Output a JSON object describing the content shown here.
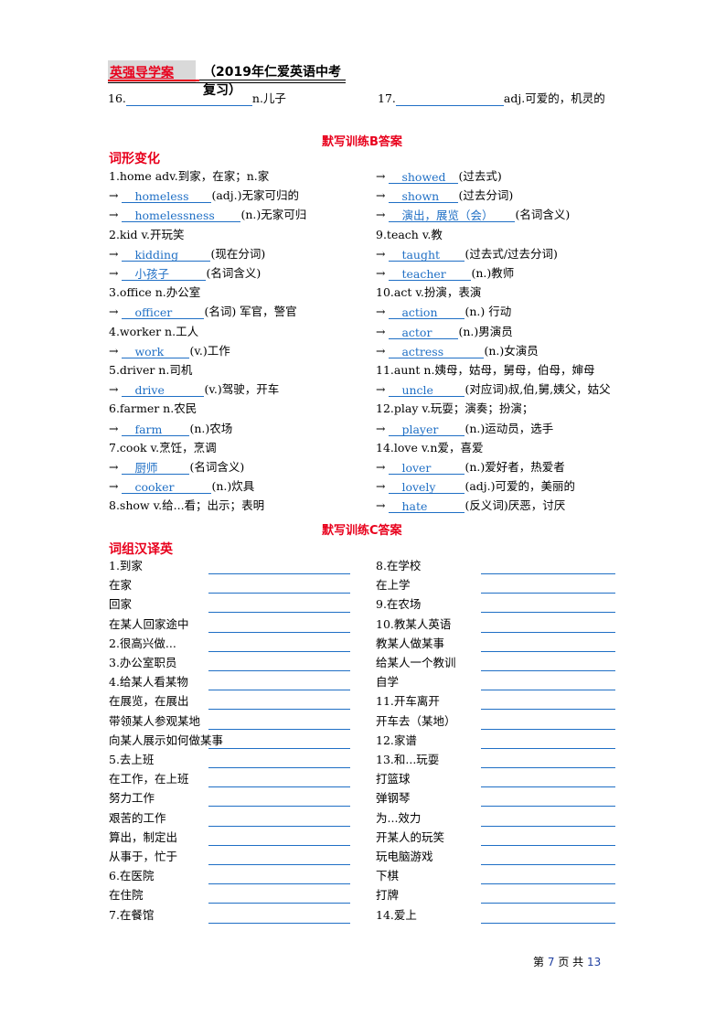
{
  "header": {
    "left": "英强导学案",
    "right": "（2019年仁爱英语中考复习）"
  },
  "top_items": [
    {
      "num": "16.",
      "suffix": "n.儿子"
    },
    {
      "num": "17.",
      "suffix": "adj.可爱的，机灵的"
    }
  ],
  "section_b": {
    "title": "默写训练B答案",
    "subtitle": "词形变化",
    "left_lines": [
      {
        "type": "head",
        "text": "1.home  adv.到家，在家；n.家"
      },
      {
        "type": "ans",
        "answer": "homeless",
        "note": "(adj.)无家可归的"
      },
      {
        "type": "ans",
        "answer": "homelessness",
        "note": "(n.)无家可归"
      },
      {
        "type": "head",
        "text": "2.kid  v.开玩笑"
      },
      {
        "type": "ans",
        "answer": "kidding",
        "note": "(现在分词)"
      },
      {
        "type": "ans",
        "answer": "小孩子",
        "note": "(名词含义)"
      },
      {
        "type": "head",
        "text": "3.office n.办公室"
      },
      {
        "type": "ans",
        "answer": "officer",
        "note": "(名词) 军官，警官"
      },
      {
        "type": "head",
        "text": "4.worker  n.工人"
      },
      {
        "type": "ans",
        "answer": "work",
        "note": "(v.)工作"
      },
      {
        "type": "head",
        "text": "5.driver  n.司机"
      },
      {
        "type": "ans",
        "answer": "drive",
        "note": "(v.)驾驶，开车"
      },
      {
        "type": "head",
        "text": "6.farmer  n.农民"
      },
      {
        "type": "ans",
        "answer": "farm",
        "note": "(n.)农场"
      },
      {
        "type": "head",
        "text": "7.cook  v.烹饪，烹调"
      },
      {
        "type": "ans",
        "answer": "厨师",
        "note": "(名词含义)"
      },
      {
        "type": "ans",
        "answer": "cooker",
        "note": "(n.)炊具"
      },
      {
        "type": "head",
        "text": "8.show  v.给...看；出示；表明"
      }
    ],
    "right_lines": [
      {
        "type": "ans",
        "answer": "showed",
        "note": "(过去式)"
      },
      {
        "type": "ans",
        "answer": "shown",
        "note": "(过去分词)"
      },
      {
        "type": "ans",
        "answer": "演出，展览（会）",
        "note": "(名词含义)"
      },
      {
        "type": "head",
        "text": "9.teach  v.教"
      },
      {
        "type": "ans",
        "answer": "taught",
        "note": "(过去式/过去分词)"
      },
      {
        "type": "ans",
        "answer": "teacher",
        "note": "(n.)教师"
      },
      {
        "type": "head",
        "text": "10.act  v.扮演，表演"
      },
      {
        "type": "ans",
        "answer": "action",
        "note": "(n.) 行动"
      },
      {
        "type": "ans",
        "answer": "actor",
        "note": "(n.)男演员"
      },
      {
        "type": "ans",
        "answer": "actress",
        "note": "(n.)女演员"
      },
      {
        "type": "head",
        "text": "11.aunt  n.姨母，姑母，舅母，伯母，婶母"
      },
      {
        "type": "ans",
        "answer": "uncle",
        "note": "(对应词)叔,伯,舅,姨父，姑父"
      },
      {
        "type": "head",
        "text": "12.play  v.玩耍；演奏；扮演；"
      },
      {
        "type": "ans",
        "answer": "player",
        "note": "(n.)运动员，选手"
      },
      {
        "type": "head",
        "text": "14.love  v.n爱，喜爱"
      },
      {
        "type": "ans",
        "answer": "lover",
        "note": "(n.)爱好者，热爱者"
      },
      {
        "type": "ans",
        "answer": "lovely",
        "note": "(adj.)可爱的，美丽的"
      },
      {
        "type": "ans",
        "answer": "hate",
        "note": "(反义词)厌恶，讨厌"
      }
    ]
  },
  "section_c": {
    "title": "默写训练C答案",
    "subtitle": "词组汉译英",
    "left_items": [
      "1.到家",
      "在家",
      "回家",
      "在某人回家途中",
      "2.很高兴做...",
      "3.办公室职员",
      "4.给某人看某物",
      "在展览，在展出",
      "带领某人参观某地",
      "向某人展示如何做某事",
      "5.去上班",
      "在工作，在上班",
      "努力工作",
      "艰苦的工作",
      "算出，制定出",
      "从事于，忙于",
      "6.在医院",
      "在住院",
      "7.在餐馆"
    ],
    "right_items": [
      "8.在学校",
      "在上学",
      "9.在农场",
      "10.教某人英语",
      "教某人做某事",
      "给某人一个教训",
      "自学",
      "11.开车离开",
      "开车去（某地）",
      "12.家谱",
      "13.和...玩耍",
      "打篮球",
      "弹钢琴",
      "为...效力",
      "开某人的玩笑",
      "玩电脑游戏",
      "下棋",
      "打牌",
      "14.爱上"
    ]
  },
  "footer": {
    "prefix": "第",
    "page": "7",
    "middle": "页 共",
    "total": "13"
  },
  "colors": {
    "accent_red": "#e8001c",
    "answer_blue": "#1f6fc5"
  }
}
